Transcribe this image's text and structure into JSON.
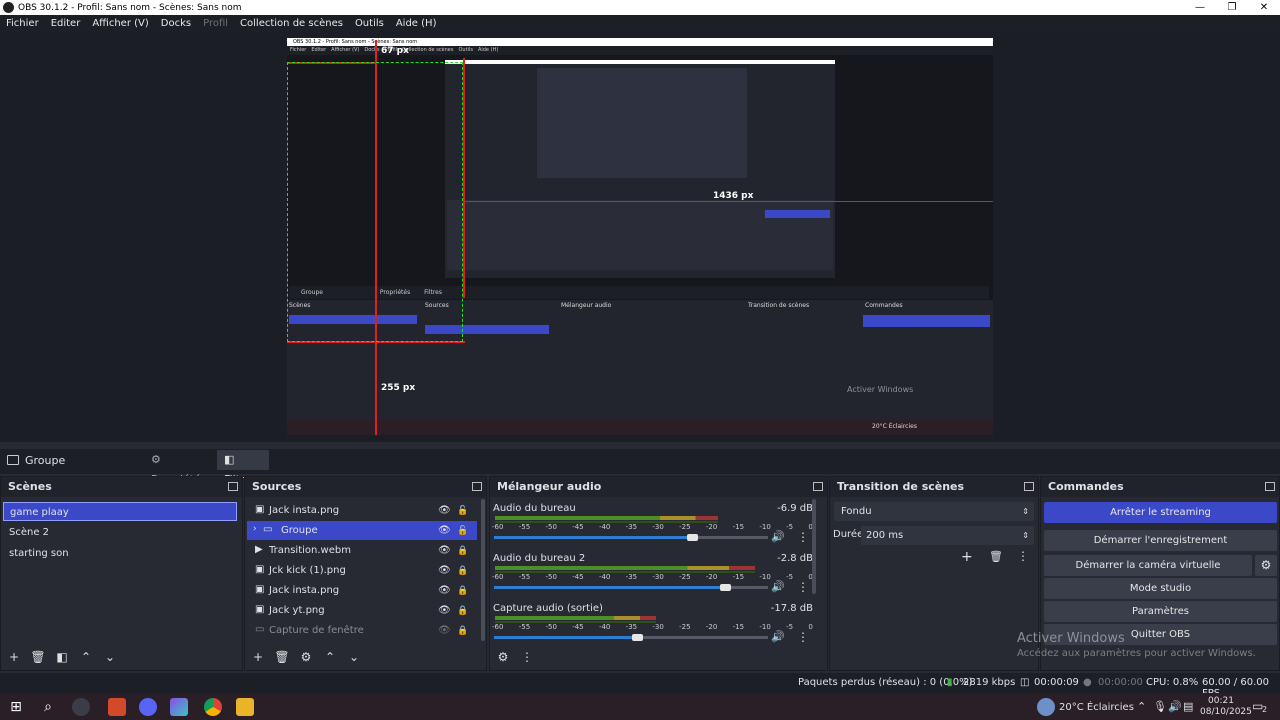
{
  "window": {
    "title": "OBS 30.1.2 - Profil: Sans nom - Scènes: Sans nom",
    "controls": [
      "—",
      "❐",
      "✕"
    ]
  },
  "menu": {
    "items": [
      "Fichier",
      "Editer",
      "Afficher (V)",
      "Docks",
      "Profil",
      "Collection de scènes",
      "Outils",
      "Aide (H)"
    ]
  },
  "preview": {
    "title": "OBS 30.1.2 - Profil: Sans nom - Scènes: Sans nom",
    "menu": [
      "Fichier",
      "Editer",
      "Afficher (V)",
      "Docks",
      "Profil",
      "Collection de scènes",
      "Outils",
      "Aide (H)"
    ],
    "label_top": "67 px",
    "label_right": "1436 px",
    "label_bottom": "255 px",
    "dock_group": "Groupe",
    "dock_props": "Propriétés",
    "dock_filters": "Filtres",
    "scenes_header": "Scènes",
    "sources_header": "Sources",
    "mixer_header": "Mélangeur audio",
    "transition_header": "Transition de scènes",
    "commands_header": "Commandes",
    "watermark": "Activer Windows",
    "taskbar_weather": "20°C Éclaircies"
  },
  "source_bar": {
    "label": "Groupe",
    "props_tab": "Propriétés",
    "filters_tab": "Filtres"
  },
  "scenes": {
    "title": "Scènes",
    "items": [
      "game plaay",
      "Scène 2",
      "starting son"
    ]
  },
  "sources": {
    "title": "Sources",
    "items": [
      "Jack insta.png",
      "Groupe",
      "Transition.webm",
      "Jck kick (1).png",
      "Jack insta.png",
      "Jack yt.png",
      "Capture de fenêtre"
    ]
  },
  "mixer": {
    "title": "Mélangeur audio",
    "scale": [
      "-60",
      "-55",
      "-50",
      "-45",
      "-40",
      "-35",
      "-30",
      "-25",
      "-20",
      "-15",
      "-10",
      "-5",
      "0"
    ],
    "tracks": [
      {
        "name": "Audio du bureau",
        "db": "-6.9 dB",
        "level": 0.72
      },
      {
        "name": "Audio du bureau 2",
        "db": "-2.8 dB",
        "level": 0.84
      },
      {
        "name": "Capture audio (sortie)",
        "db": "-17.8 dB",
        "level": 0.52
      }
    ]
  },
  "transition": {
    "title": "Transition de scènes",
    "type": "Fondu",
    "duration_label": "Durée",
    "duration_value": "200 ms"
  },
  "commands": {
    "title": "Commandes",
    "buttons": [
      "Arrêter le streaming",
      "Démarrer l'enregistrement",
      "Démarrer la caméra virtuelle",
      "Mode studio",
      "Paramètres",
      "Quitter OBS"
    ]
  },
  "watermark": {
    "line1": "Activer Windows",
    "line2": "Accédez aux paramètres pour activer Windows."
  },
  "status": {
    "dropped": "Paquets perdus (réseau) : 0 (0.0%)",
    "bitrate": "2819 kbps",
    "stream_time": "00:00:09",
    "rec_time": "00:00:00",
    "cpu": "CPU: 0.8%",
    "fps": "60.00 / 60.00 FPS"
  },
  "taskbar": {
    "weather": "20°C  Éclaircies",
    "time": "00:21",
    "date": "08/10/2025",
    "notif": "2"
  }
}
